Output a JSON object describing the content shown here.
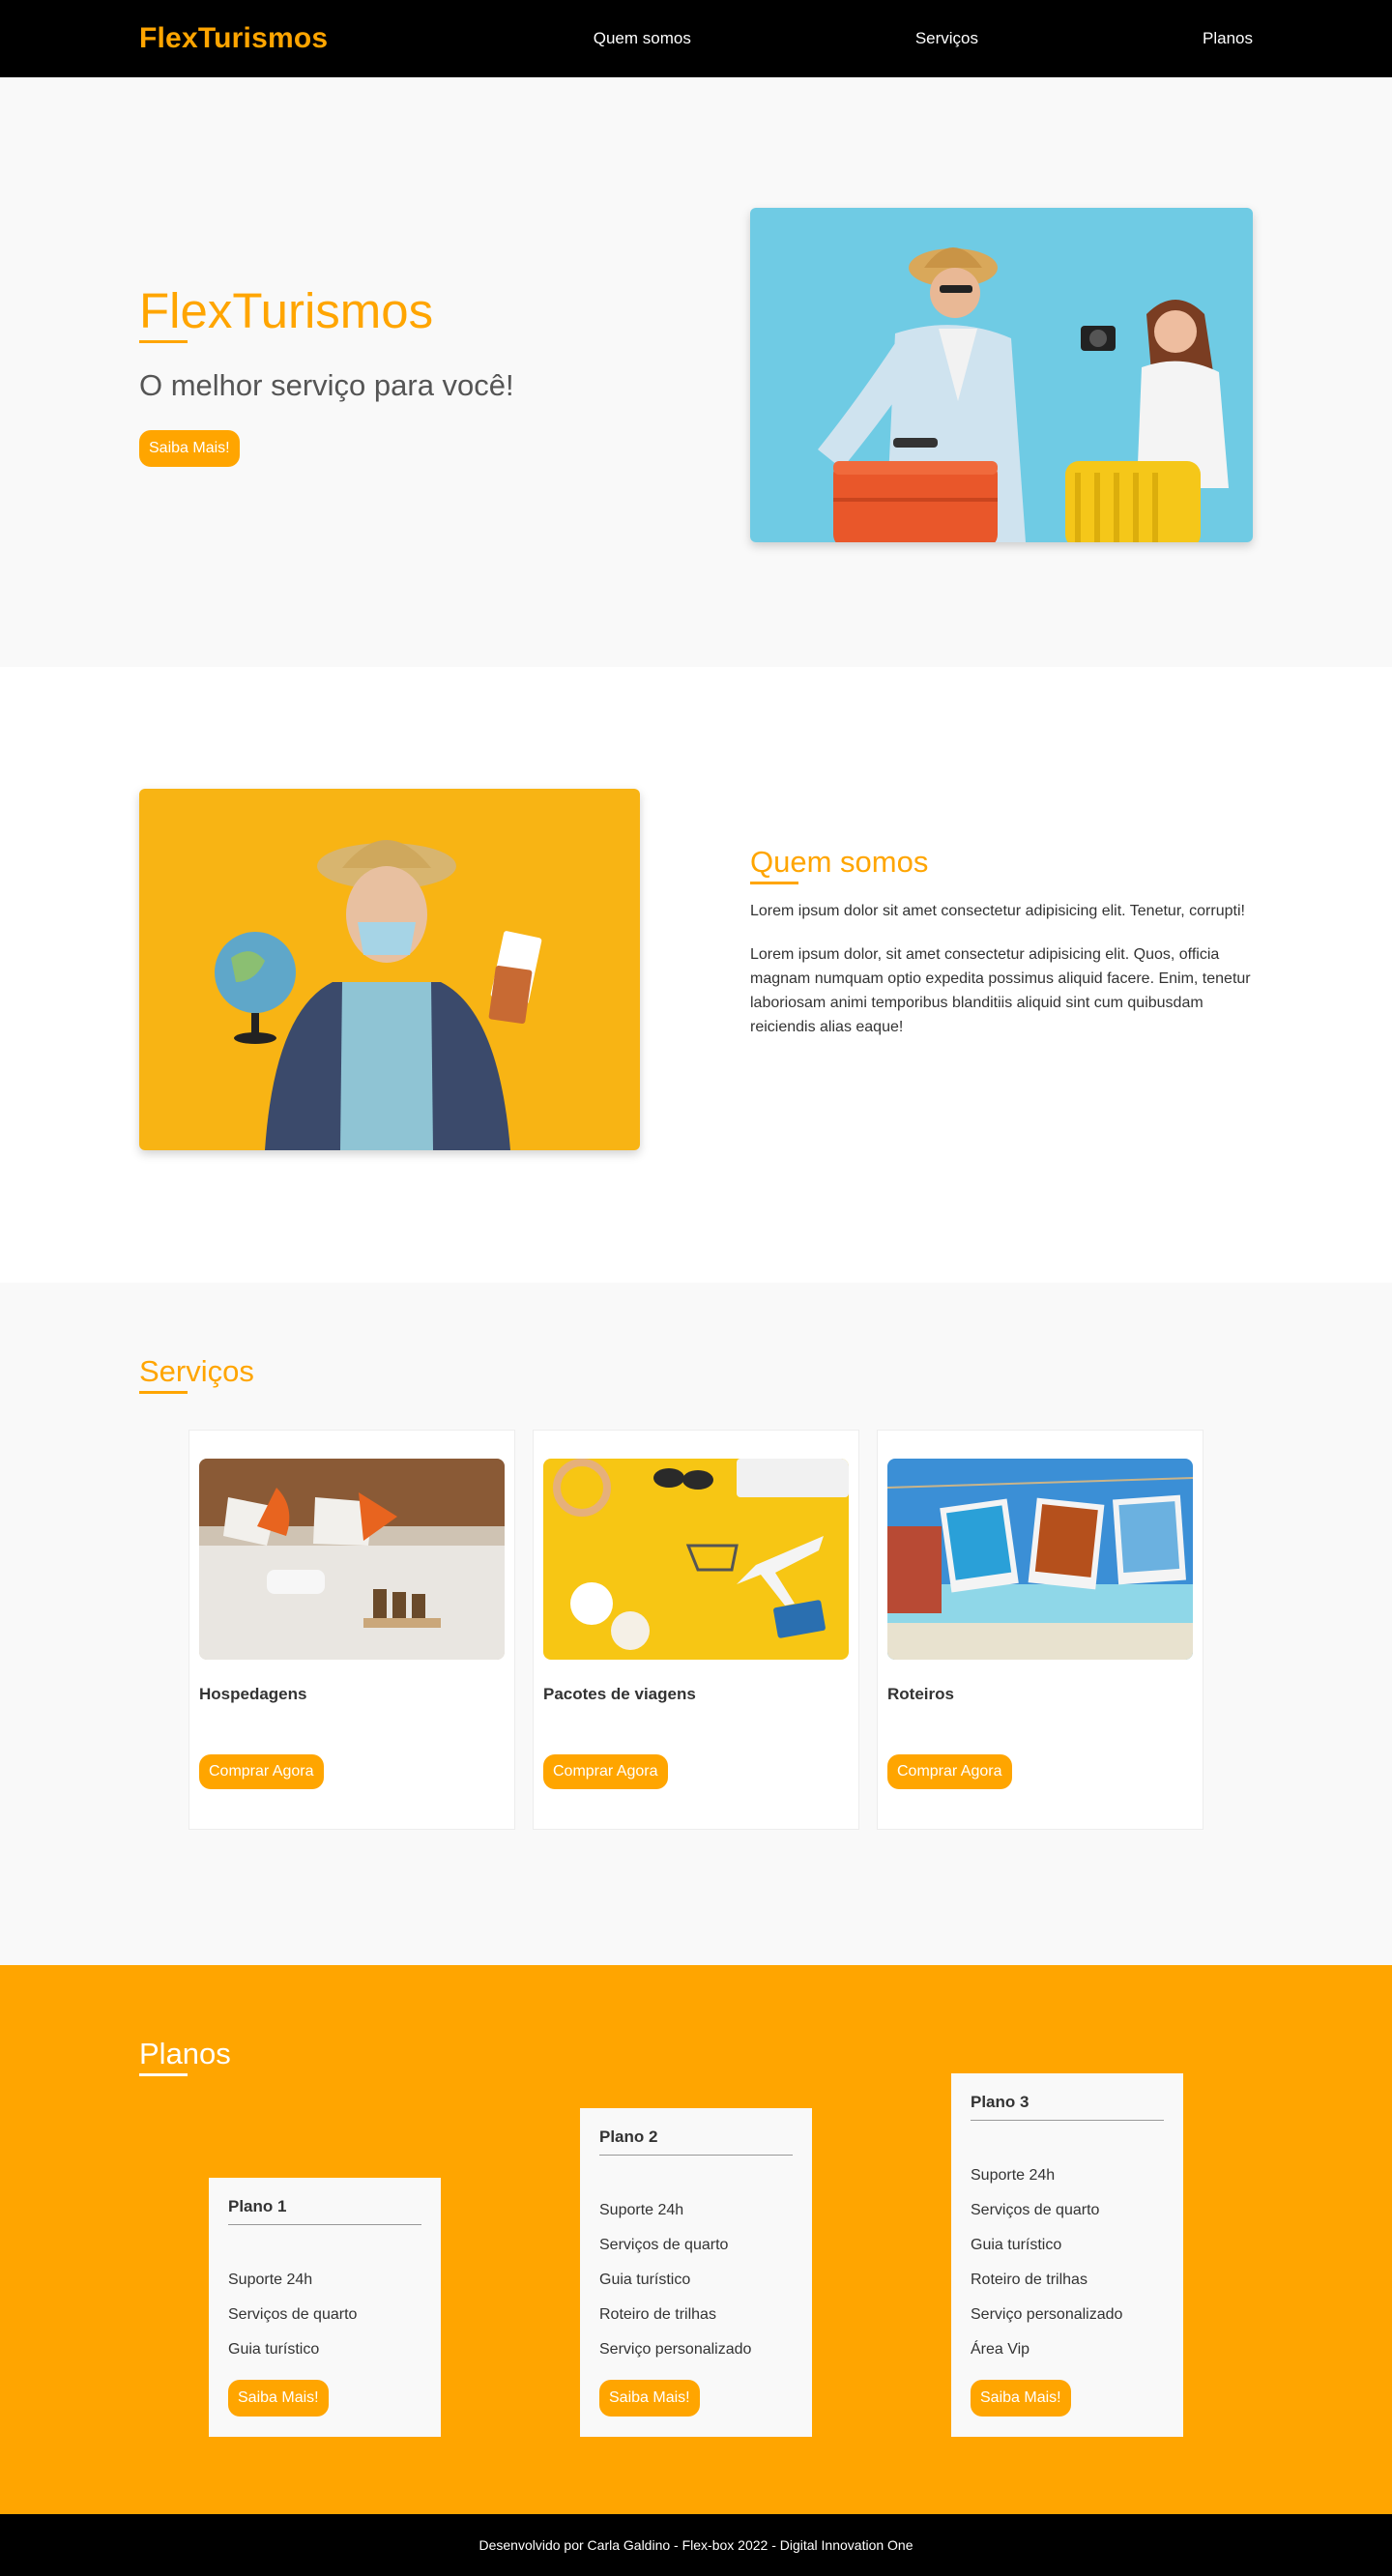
{
  "header": {
    "logo": "FlexTurismos",
    "nav": [
      "Quem somos",
      "Serviços",
      "Planos"
    ]
  },
  "hero": {
    "title": "FlexTurismos",
    "subtitle": "O melhor serviço para você!",
    "button": "Saiba Mais!"
  },
  "about": {
    "title": "Quem somos",
    "p1": "Lorem ipsum dolor sit amet consectetur adipisicing elit. Tenetur, corrupti!",
    "p2": "Lorem ipsum dolor, sit amet consectetur adipisicing elit. Quos, officia magnam numquam optio expedita possimus aliquid facere. Enim, tenetur laboriosam animi temporibus blanditiis aliquid sint cum quibusdam reiciendis alias eaque!"
  },
  "services": {
    "title": "Serviços",
    "cards": [
      {
        "title": "Hospedagens",
        "button": "Comprar Agora"
      },
      {
        "title": "Pacotes de viagens",
        "button": "Comprar Agora"
      },
      {
        "title": "Roteiros",
        "button": "Comprar Agora"
      }
    ]
  },
  "plans": {
    "title": "Planos",
    "items": [
      {
        "title": "Plano 1",
        "features": [
          "Suporte 24h",
          "Serviços de quarto",
          "Guia turístico"
        ],
        "button": "Saiba Mais!"
      },
      {
        "title": "Plano 2",
        "features": [
          "Suporte 24h",
          "Serviços de quarto",
          "Guia turístico",
          "Roteiro de trilhas",
          "Serviço personalizado"
        ],
        "button": "Saiba Mais!"
      },
      {
        "title": "Plano 3",
        "features": [
          "Suporte 24h",
          "Serviços de quarto",
          "Guia turístico",
          "Roteiro de trilhas",
          "Serviço personalizado",
          "Área Vip"
        ],
        "button": "Saiba Mais!"
      }
    ]
  },
  "footer": {
    "text": "Desenvolvido por Carla Galdino - Flex-box 2022 - Digital Innovation One"
  },
  "colors": {
    "accent": "#ffa500",
    "header_bg": "#000000",
    "section_bg": "#f9f9f9"
  }
}
